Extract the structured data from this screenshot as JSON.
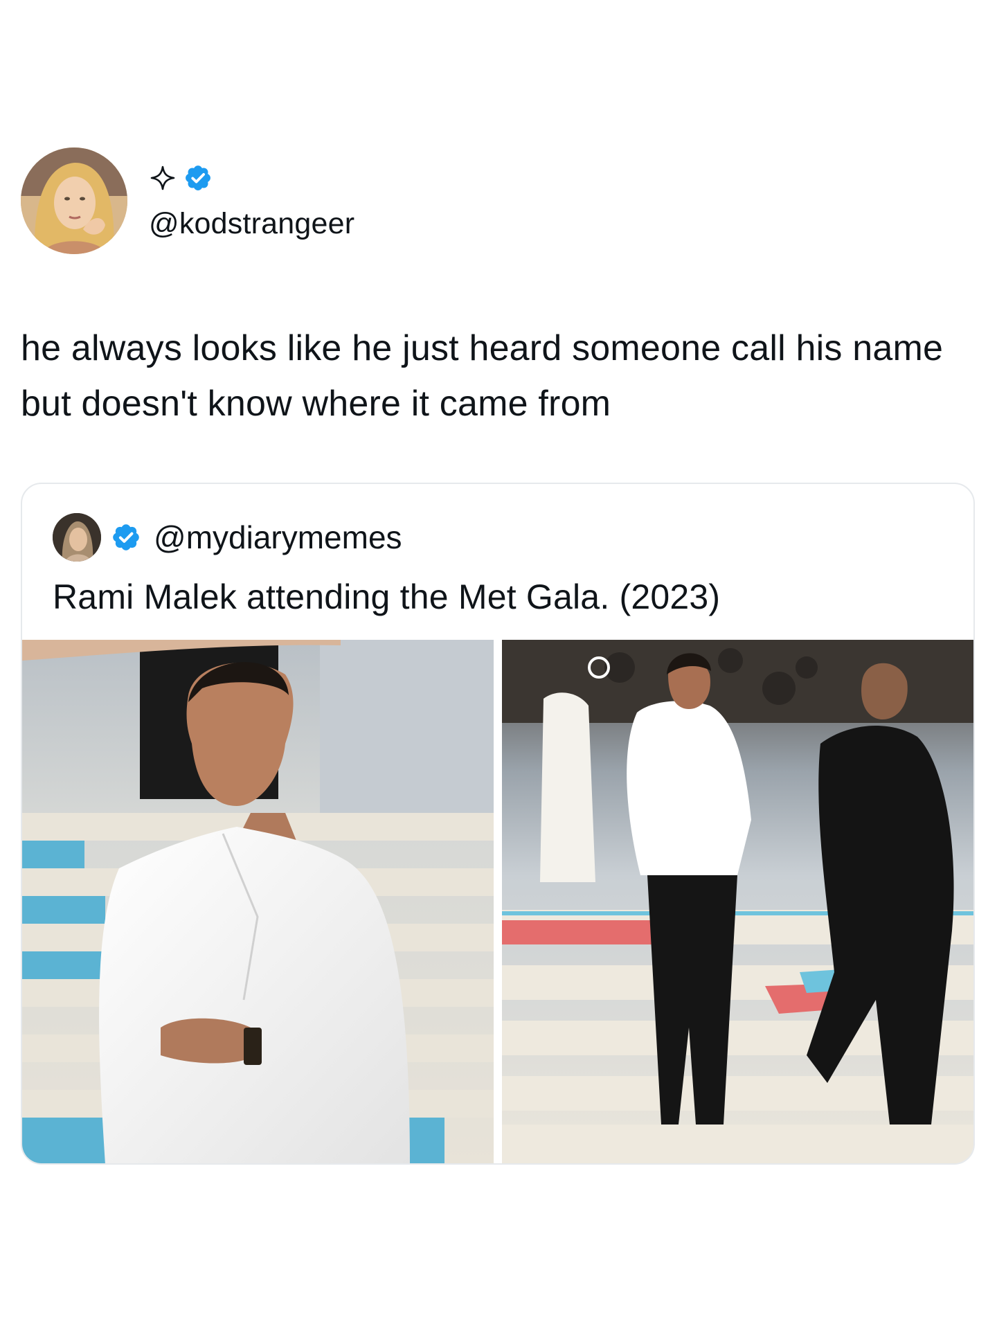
{
  "author": {
    "handle": "@kodstrangeer",
    "badge_icon": "sparkle-icon",
    "verified_icon": "verified-badge-icon",
    "verified_color": "#1d9bf0"
  },
  "tweet": {
    "text": "he always looks like he just heard someone call his name but doesn't know where it came from"
  },
  "quoted_tweet": {
    "handle": "@mydiarymemes",
    "verified_icon": "verified-badge-icon",
    "text": "Rami Malek attending the Met Gala. (2023)",
    "media": [
      {
        "name": "met-gala-closeup-photo"
      },
      {
        "name": "met-gala-stairs-photo"
      }
    ]
  }
}
